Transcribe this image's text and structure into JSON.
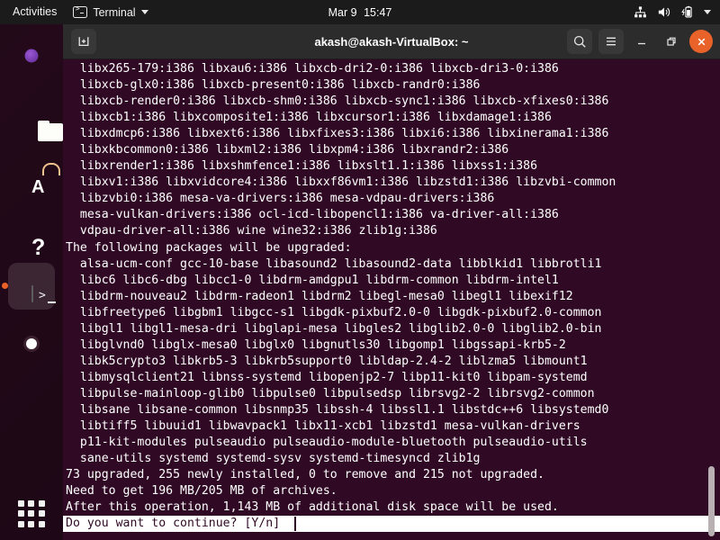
{
  "topbar": {
    "activities": "Activities",
    "app_name": "Terminal",
    "app_icon": "terminal-icon",
    "clock_date": "Mar 9",
    "clock_time": "15:47",
    "tray_icons": [
      "network-icon",
      "volume-icon",
      "battery-icon",
      "chevron-down-icon"
    ]
  },
  "dock": {
    "items": [
      {
        "name": "firefox",
        "label": "Firefox Web Browser",
        "active": false
      },
      {
        "name": "files",
        "label": "Files",
        "active": false
      },
      {
        "name": "software",
        "label": "Ubuntu Software",
        "active": false,
        "glyph": "A"
      },
      {
        "name": "help",
        "label": "Help",
        "active": false,
        "glyph": "?"
      },
      {
        "name": "terminal",
        "label": "Terminal",
        "active": true
      },
      {
        "name": "disc",
        "label": "Disc Image Mounter",
        "active": false
      }
    ],
    "show_apps_label": "Show Applications"
  },
  "window": {
    "title": "akash@akash-VirtualBox: ~",
    "new_tab_label": "New Tab",
    "search_label": "Search",
    "menu_label": "Menu",
    "minimize_label": "Minimize",
    "maximize_label": "Restore",
    "close_label": "Close"
  },
  "terminal": {
    "background": "#300a24",
    "foreground": "#ffffff",
    "lines": [
      "  libx265-179:i386 libxau6:i386 libxcb-dri2-0:i386 libxcb-dri3-0:i386",
      "  libxcb-glx0:i386 libxcb-present0:i386 libxcb-randr0:i386",
      "  libxcb-render0:i386 libxcb-shm0:i386 libxcb-sync1:i386 libxcb-xfixes0:i386",
      "  libxcb1:i386 libxcomposite1:i386 libxcursor1:i386 libxdamage1:i386",
      "  libxdmcp6:i386 libxext6:i386 libxfixes3:i386 libxi6:i386 libxinerama1:i386",
      "  libxkbcommon0:i386 libxml2:i386 libxpm4:i386 libxrandr2:i386",
      "  libxrender1:i386 libxshmfence1:i386 libxslt1.1:i386 libxss1:i386",
      "  libxv1:i386 libxvidcore4:i386 libxxf86vm1:i386 libzstd1:i386 libzvbi-common",
      "  libzvbi0:i386 mesa-va-drivers:i386 mesa-vdpau-drivers:i386",
      "  mesa-vulkan-drivers:i386 ocl-icd-libopencl1:i386 va-driver-all:i386",
      "  vdpau-driver-all:i386 wine wine32:i386 zlib1g:i386",
      "The following packages will be upgraded:",
      "  alsa-ucm-conf gcc-10-base libasound2 libasound2-data libblkid1 libbrotli1",
      "  libc6 libc6-dbg libcc1-0 libdrm-amdgpu1 libdrm-common libdrm-intel1",
      "  libdrm-nouveau2 libdrm-radeon1 libdrm2 libegl-mesa0 libegl1 libexif12",
      "  libfreetype6 libgbm1 libgcc-s1 libgdk-pixbuf2.0-0 libgdk-pixbuf2.0-common",
      "  libgl1 libgl1-mesa-dri libglapi-mesa libgles2 libglib2.0-0 libglib2.0-bin",
      "  libglvnd0 libglx-mesa0 libglx0 libgnutls30 libgomp1 libgssapi-krb5-2",
      "  libk5crypto3 libkrb5-3 libkrb5support0 libldap-2.4-2 liblzma5 libmount1",
      "  libmysqlclient21 libnss-systemd libopenjp2-7 libp11-kit0 libpam-systemd",
      "  libpulse-mainloop-glib0 libpulse0 libpulsedsp librsvg2-2 librsvg2-common",
      "  libsane libsane-common libsnmp35 libssh-4 libssl1.1 libstdc++6 libsystemd0",
      "  libtiff5 libuuid1 libwavpack1 libx11-xcb1 libzstd1 mesa-vulkan-drivers",
      "  p11-kit-modules pulseaudio pulseaudio-module-bluetooth pulseaudio-utils",
      "  sane-utils systemd systemd-sysv systemd-timesyncd zlib1g",
      "73 upgraded, 255 newly installed, 0 to remove and 215 not upgraded.",
      "Need to get 196 MB/205 MB of archives.",
      "After this operation, 1,143 MB of additional disk space will be used."
    ],
    "prompt_line": "Do you want to continue? [Y/n] ",
    "cursor_visible": true
  }
}
